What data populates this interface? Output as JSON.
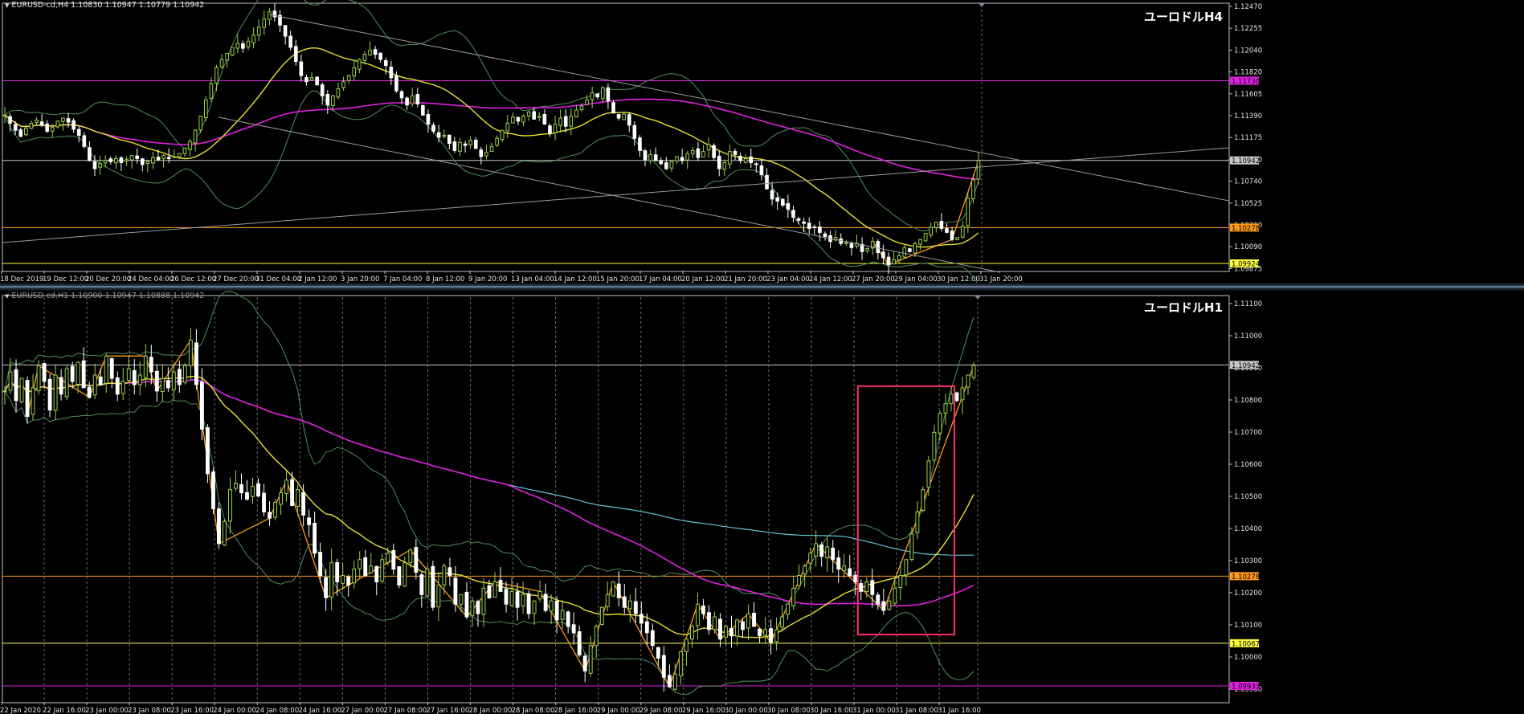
{
  "chart_data": [
    {
      "type": "candlestick",
      "symbol_info": "EURUSD-cd,H4  1.10830 1.10947 1.10779 1.10942",
      "title": "ユーロドルH4",
      "x_ticks": [
        "18 Dec 2019",
        "19 Dec 12:00",
        "20 Dec 20:00",
        "24 Dec 04:00",
        "26 Dec 12:00",
        "27 Dec 20:00",
        "31 Dec 04:00",
        "2 Jan 12:00",
        "3 Jan 20:00",
        "7 Jan 04:00",
        "8 Jan 12:00",
        "9 Jan 20:00",
        "13 Jan 04:00",
        "14 Jan 12:00",
        "15 Jan 20:00",
        "17 Jan 04:00",
        "20 Jan 12:00",
        "21 Jan 20:00",
        "23 Jan 04:00",
        "24 Jan 12:00",
        "27 Jan 20:00",
        "29 Jan 04:00",
        "30 Jan 12:00",
        "31 Jan 20:00"
      ],
      "y_ticks": [
        "1.12470",
        "1.12255",
        "1.12040",
        "1.11820",
        "1.11605",
        "1.11390",
        "1.11175",
        "1.10960",
        "1.10740",
        "1.10525",
        "1.10310",
        "1.10090",
        "1.09875"
      ],
      "ylim": [
        1.0986,
        1.1248
      ],
      "closes": [
        1.1139,
        1.1131,
        1.1124,
        1.1118,
        1.1126,
        1.1131,
        1.1134,
        1.1129,
        1.1123,
        1.1127,
        1.1133,
        1.1136,
        1.1132,
        1.1125,
        1.1119,
        1.1108,
        1.1094,
        1.1086,
        1.1091,
        1.1094,
        1.1093,
        1.1096,
        1.1092,
        1.1095,
        1.1099,
        1.1096,
        1.109,
        1.1093,
        1.1097,
        1.1095,
        1.1099,
        1.1096,
        1.1098,
        1.1101,
        1.1106,
        1.1113,
        1.1124,
        1.1138,
        1.1154,
        1.117,
        1.1186,
        1.1194,
        1.12,
        1.1206,
        1.121,
        1.1205,
        1.1212,
        1.1218,
        1.1226,
        1.1234,
        1.1241,
        1.1236,
        1.1228,
        1.1217,
        1.1206,
        1.1192,
        1.1178,
        1.1172,
        1.1176,
        1.1169,
        1.1158,
        1.1149,
        1.1158,
        1.1165,
        1.1172,
        1.1178,
        1.1186,
        1.1194,
        1.1199,
        1.1203,
        1.1199,
        1.1194,
        1.1188,
        1.1176,
        1.1163,
        1.1156,
        1.1149,
        1.1158,
        1.115,
        1.1139,
        1.113,
        1.1123,
        1.1117,
        1.1119,
        1.1111,
        1.1104,
        1.1112,
        1.1109,
        1.1114,
        1.1106,
        1.1098,
        1.1102,
        1.1108,
        1.1116,
        1.1124,
        1.1131,
        1.1137,
        1.1133,
        1.1138,
        1.1142,
        1.1135,
        1.1138,
        1.113,
        1.1121,
        1.113,
        1.1136,
        1.1128,
        1.1138,
        1.1144,
        1.1148,
        1.1154,
        1.1161,
        1.1157,
        1.1166,
        1.1153,
        1.1141,
        1.1136,
        1.114,
        1.1129,
        1.1116,
        1.1104,
        1.1095,
        1.11,
        1.1094,
        1.1091,
        1.1086,
        1.1093,
        1.1098,
        1.1094,
        1.1101,
        1.1104,
        1.1097,
        1.1103,
        1.111,
        1.1097,
        1.1086,
        1.1092,
        1.1103,
        1.11,
        1.1094,
        1.1096,
        1.1092,
        1.109,
        1.108,
        1.1066,
        1.1056,
        1.1054,
        1.105,
        1.1046,
        1.1038,
        1.1035,
        1.1032,
        1.1027,
        1.1028,
        1.1023,
        1.1019,
        1.1014,
        1.1018,
        1.1012,
        1.1013,
        1.1008,
        1.1012,
        1.1004,
        1.1007,
        1.1014,
        1.1003,
        1.0998,
        1.0991,
        1.0996,
        1.1,
        1.1008,
        1.1004,
        1.1012,
        1.1016,
        1.1022,
        1.1028,
        1.1033,
        1.1027,
        1.1023,
        1.1016,
        1.1018,
        1.1029,
        1.1057,
        1.1075,
        1.1094
      ],
      "horizontal_levels": [
        {
          "price": "1.11730",
          "color": "#e020e0"
        },
        {
          "price": "1.10942",
          "color": "#c8c8c8"
        },
        {
          "price": "1.10278",
          "color": "#ff9a1a"
        },
        {
          "price": "1.09924",
          "color": "#ffff40"
        }
      ]
    },
    {
      "type": "candlestick",
      "symbol_info": "EURUSD-cd,H1  1.10900 1.10947 1.10888 1.10942",
      "title": "ユーロドルH1",
      "x_ticks": [
        "22 Jan 2020",
        "22 Jan 16:00",
        "23 Jan 00:00",
        "23 Jan 08:00",
        "23 Jan 16:00",
        "24 Jan 00:00",
        "24 Jan 08:00",
        "24 Jan 16:00",
        "27 Jan 00:00",
        "27 Jan 08:00",
        "27 Jan 16:00",
        "28 Jan 00:00",
        "28 Jan 08:00",
        "28 Jan 16:00",
        "29 Jan 00:00",
        "29 Jan 08:00",
        "29 Jan 16:00",
        "30 Jan 00:00",
        "30 Jan 08:00",
        "30 Jan 16:00",
        "31 Jan 00:00",
        "31 Jan 08:00",
        "31 Jan 16:00"
      ],
      "y_ticks": [
        "1.11100",
        "1.11000",
        "1.10900",
        "1.10800",
        "1.10700",
        "1.10600",
        "1.10500",
        "1.10400",
        "1.10300",
        "1.10200",
        "1.10100",
        "1.10000",
        "1.09900"
      ],
      "ylim": [
        1.09885,
        1.11155
      ],
      "closes": [
        1.1086,
        1.1092,
        1.1083,
        1.109,
        1.1078,
        1.1087,
        1.1094,
        1.1089,
        1.108,
        1.1091,
        1.1085,
        1.1093,
        1.1089,
        1.1095,
        1.1087,
        1.1084,
        1.1091,
        1.1088,
        1.1097,
        1.109,
        1.1085,
        1.1089,
        1.1093,
        1.1088,
        1.1091,
        1.1097,
        1.1092,
        1.1086,
        1.109,
        1.1087,
        1.1092,
        1.1088,
        1.1094,
        1.1102,
        1.1088,
        1.1074,
        1.106,
        1.1049,
        1.1038,
        1.1045,
        1.1055,
        1.1057,
        1.1054,
        1.1052,
        1.1056,
        1.1053,
        1.1048,
        1.1046,
        1.1051,
        1.1054,
        1.1058,
        1.105,
        1.1055,
        1.1047,
        1.1044,
        1.1035,
        1.1028,
        1.1021,
        1.1032,
        1.1026,
        1.1028,
        1.1025,
        1.103,
        1.1033,
        1.1028,
        1.1031,
        1.1026,
        1.1033,
        1.1035,
        1.103,
        1.1025,
        1.1032,
        1.1036,
        1.1029,
        1.1022,
        1.103,
        1.1018,
        1.1025,
        1.1031,
        1.1028,
        1.1019,
        1.1022,
        1.1015,
        1.102,
        1.1016,
        1.1024,
        1.1021,
        1.1026,
        1.1023,
        1.1019,
        1.1023,
        1.1018,
        1.1022,
        1.1016,
        1.102,
        1.1023,
        1.1017,
        1.102,
        1.1014,
        1.1017,
        1.1012,
        1.101,
        1.1003,
        1.0998,
        1.1006,
        1.1012,
        1.1018,
        1.1022,
        1.1026,
        1.1021,
        1.1018,
        1.102,
        1.1016,
        1.1013,
        1.101,
        1.1006,
        1.1002,
        1.0996,
        1.0993,
        1.0997,
        1.1004,
        1.1008,
        1.1012,
        1.1019,
        1.1016,
        1.1011,
        1.1015,
        1.1008,
        1.1012,
        1.1009,
        1.1014,
        1.1011,
        1.1016,
        1.1012,
        1.1009,
        1.1011,
        1.1007,
        1.1011,
        1.1015,
        1.1019,
        1.1024,
        1.1028,
        1.1031,
        1.1035,
        1.1038,
        1.1034,
        1.1037,
        1.1033,
        1.103,
        1.1031,
        1.1028,
        1.1026,
        1.1023,
        1.1026,
        1.1022,
        1.1019,
        1.1017,
        1.102,
        1.1024,
        1.1028,
        1.1033,
        1.1041,
        1.1048,
        1.1055,
        1.1064,
        1.1073,
        1.1079,
        1.1082,
        1.1085,
        1.1083,
        1.1087,
        1.1091,
        1.1094
      ],
      "horizontal_levels": [
        {
          "price": "1.10942",
          "color": "#c8c8c8"
        },
        {
          "price": "1.10278",
          "color": "#ff9a1a"
        },
        {
          "price": "1.10067",
          "color": "#ffff40"
        },
        {
          "price": "1.09933",
          "color": "#e020e0"
        }
      ],
      "highlight_box": {
        "color": "#ff2d6f",
        "from_index": 152,
        "to_index": 168
      }
    }
  ]
}
